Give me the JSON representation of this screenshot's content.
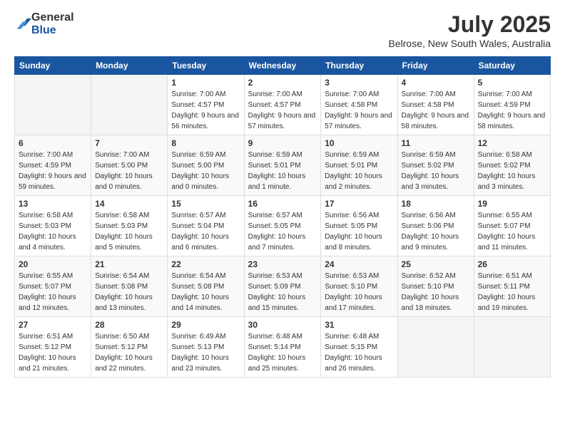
{
  "header": {
    "logo": {
      "general": "General",
      "blue": "Blue"
    },
    "title": "July 2025",
    "location": "Belrose, New South Wales, Australia"
  },
  "calendar": {
    "days_of_week": [
      "Sunday",
      "Monday",
      "Tuesday",
      "Wednesday",
      "Thursday",
      "Friday",
      "Saturday"
    ],
    "weeks": [
      [
        {
          "day": "",
          "info": ""
        },
        {
          "day": "",
          "info": ""
        },
        {
          "day": "1",
          "info": "Sunrise: 7:00 AM\nSunset: 4:57 PM\nDaylight: 9 hours and 56 minutes."
        },
        {
          "day": "2",
          "info": "Sunrise: 7:00 AM\nSunset: 4:57 PM\nDaylight: 9 hours and 57 minutes."
        },
        {
          "day": "3",
          "info": "Sunrise: 7:00 AM\nSunset: 4:58 PM\nDaylight: 9 hours and 57 minutes."
        },
        {
          "day": "4",
          "info": "Sunrise: 7:00 AM\nSunset: 4:58 PM\nDaylight: 9 hours and 58 minutes."
        },
        {
          "day": "5",
          "info": "Sunrise: 7:00 AM\nSunset: 4:59 PM\nDaylight: 9 hours and 58 minutes."
        }
      ],
      [
        {
          "day": "6",
          "info": "Sunrise: 7:00 AM\nSunset: 4:59 PM\nDaylight: 9 hours and 59 minutes."
        },
        {
          "day": "7",
          "info": "Sunrise: 7:00 AM\nSunset: 5:00 PM\nDaylight: 10 hours and 0 minutes."
        },
        {
          "day": "8",
          "info": "Sunrise: 6:59 AM\nSunset: 5:00 PM\nDaylight: 10 hours and 0 minutes."
        },
        {
          "day": "9",
          "info": "Sunrise: 6:59 AM\nSunset: 5:01 PM\nDaylight: 10 hours and 1 minute."
        },
        {
          "day": "10",
          "info": "Sunrise: 6:59 AM\nSunset: 5:01 PM\nDaylight: 10 hours and 2 minutes."
        },
        {
          "day": "11",
          "info": "Sunrise: 6:59 AM\nSunset: 5:02 PM\nDaylight: 10 hours and 3 minutes."
        },
        {
          "day": "12",
          "info": "Sunrise: 6:58 AM\nSunset: 5:02 PM\nDaylight: 10 hours and 3 minutes."
        }
      ],
      [
        {
          "day": "13",
          "info": "Sunrise: 6:58 AM\nSunset: 5:03 PM\nDaylight: 10 hours and 4 minutes."
        },
        {
          "day": "14",
          "info": "Sunrise: 6:58 AM\nSunset: 5:03 PM\nDaylight: 10 hours and 5 minutes."
        },
        {
          "day": "15",
          "info": "Sunrise: 6:57 AM\nSunset: 5:04 PM\nDaylight: 10 hours and 6 minutes."
        },
        {
          "day": "16",
          "info": "Sunrise: 6:57 AM\nSunset: 5:05 PM\nDaylight: 10 hours and 7 minutes."
        },
        {
          "day": "17",
          "info": "Sunrise: 6:56 AM\nSunset: 5:05 PM\nDaylight: 10 hours and 8 minutes."
        },
        {
          "day": "18",
          "info": "Sunrise: 6:56 AM\nSunset: 5:06 PM\nDaylight: 10 hours and 9 minutes."
        },
        {
          "day": "19",
          "info": "Sunrise: 6:55 AM\nSunset: 5:07 PM\nDaylight: 10 hours and 11 minutes."
        }
      ],
      [
        {
          "day": "20",
          "info": "Sunrise: 6:55 AM\nSunset: 5:07 PM\nDaylight: 10 hours and 12 minutes."
        },
        {
          "day": "21",
          "info": "Sunrise: 6:54 AM\nSunset: 5:08 PM\nDaylight: 10 hours and 13 minutes."
        },
        {
          "day": "22",
          "info": "Sunrise: 6:54 AM\nSunset: 5:08 PM\nDaylight: 10 hours and 14 minutes."
        },
        {
          "day": "23",
          "info": "Sunrise: 6:53 AM\nSunset: 5:09 PM\nDaylight: 10 hours and 15 minutes."
        },
        {
          "day": "24",
          "info": "Sunrise: 6:53 AM\nSunset: 5:10 PM\nDaylight: 10 hours and 17 minutes."
        },
        {
          "day": "25",
          "info": "Sunrise: 6:52 AM\nSunset: 5:10 PM\nDaylight: 10 hours and 18 minutes."
        },
        {
          "day": "26",
          "info": "Sunrise: 6:51 AM\nSunset: 5:11 PM\nDaylight: 10 hours and 19 minutes."
        }
      ],
      [
        {
          "day": "27",
          "info": "Sunrise: 6:51 AM\nSunset: 5:12 PM\nDaylight: 10 hours and 21 minutes."
        },
        {
          "day": "28",
          "info": "Sunrise: 6:50 AM\nSunset: 5:12 PM\nDaylight: 10 hours and 22 minutes."
        },
        {
          "day": "29",
          "info": "Sunrise: 6:49 AM\nSunset: 5:13 PM\nDaylight: 10 hours and 23 minutes."
        },
        {
          "day": "30",
          "info": "Sunrise: 6:48 AM\nSunset: 5:14 PM\nDaylight: 10 hours and 25 minutes."
        },
        {
          "day": "31",
          "info": "Sunrise: 6:48 AM\nSunset: 5:15 PM\nDaylight: 10 hours and 26 minutes."
        },
        {
          "day": "",
          "info": ""
        },
        {
          "day": "",
          "info": ""
        }
      ]
    ]
  }
}
